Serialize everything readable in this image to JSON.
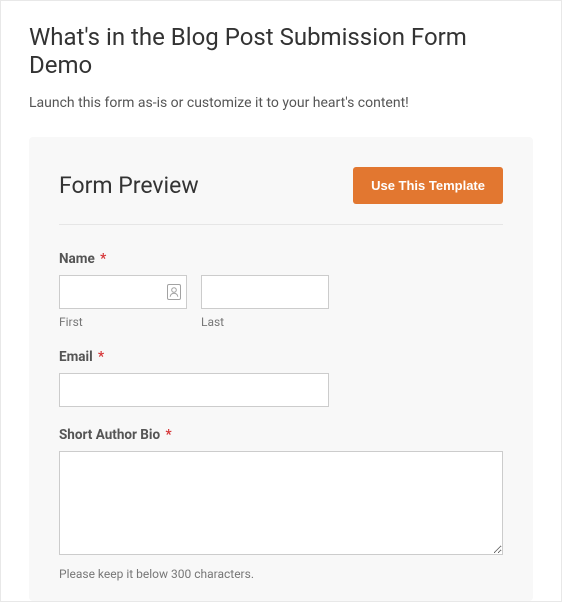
{
  "page": {
    "title": "What's in the Blog Post Submission Form Demo",
    "subtitle": "Launch this form as-is or customize it to your heart's content!"
  },
  "card": {
    "title": "Form Preview",
    "button": "Use This Template"
  },
  "form": {
    "name": {
      "label": "Name",
      "first_sub": "First",
      "last_sub": "Last"
    },
    "email": {
      "label": "Email"
    },
    "bio": {
      "label": "Short Author Bio",
      "helper": "Please keep it below 300 characters."
    },
    "required_mark": "*"
  }
}
